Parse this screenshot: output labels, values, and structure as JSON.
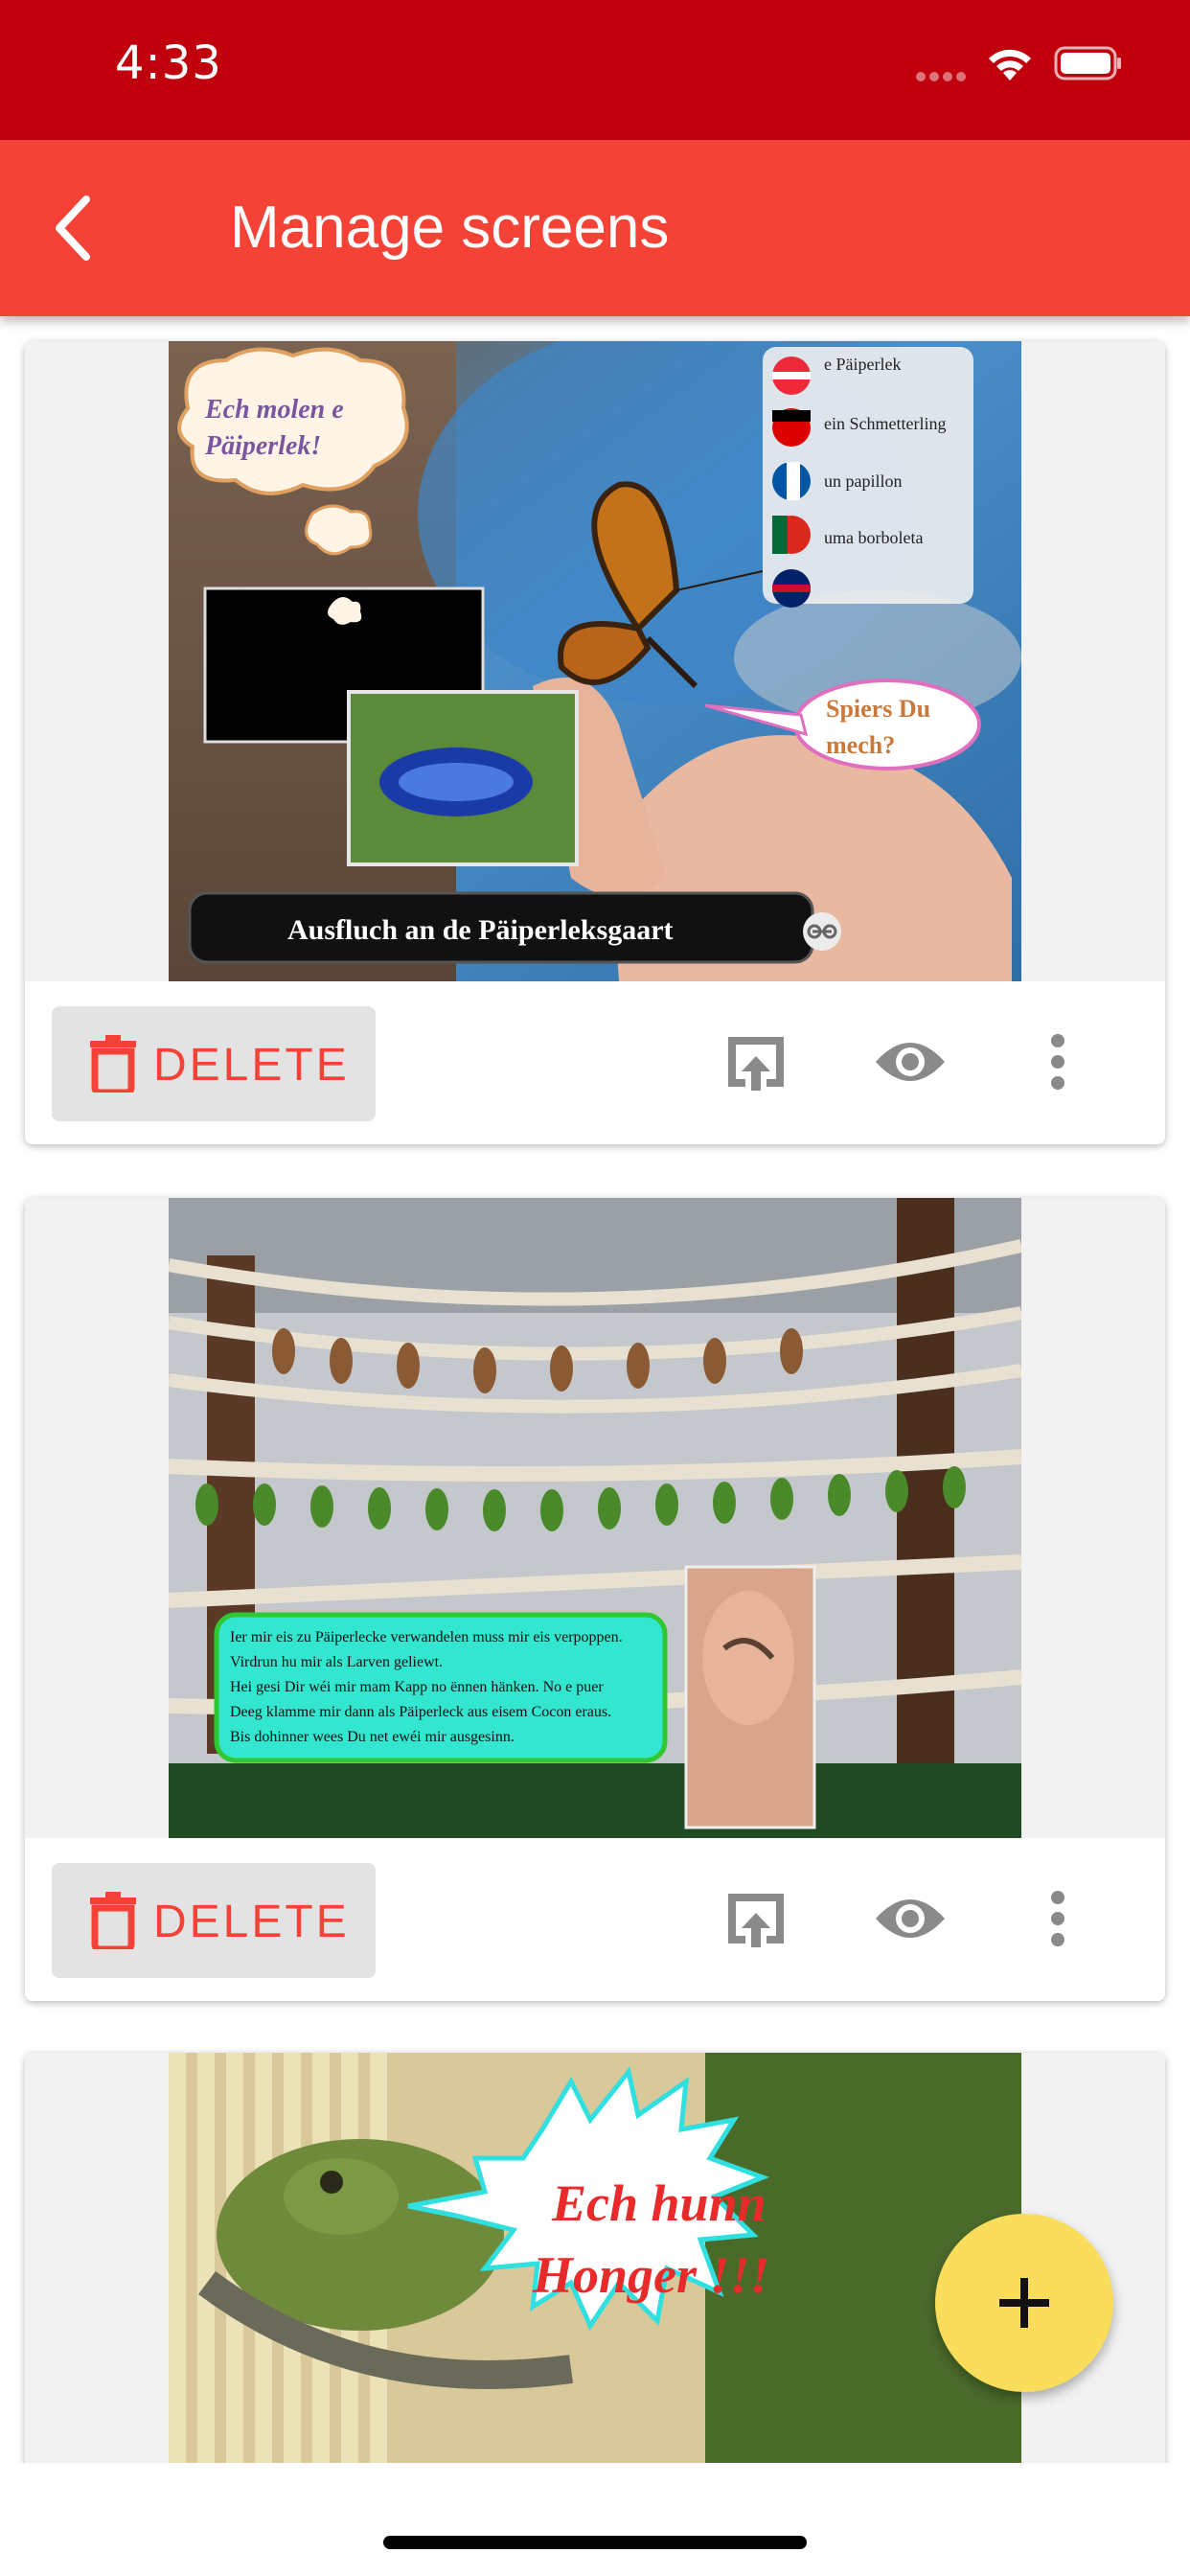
{
  "status_bar": {
    "time": "4:33"
  },
  "app_bar": {
    "title": "Manage screens",
    "back_icon": "arrow-back-icon"
  },
  "cards": [
    {
      "delete_label": "DELETE",
      "thumbnail": {
        "bubble_top": "Ech molen e Päiperlek!",
        "languages": [
          "e Päiperlek",
          "ein Schmetterling",
          "un papillon",
          "uma borboleta"
        ],
        "bubble_speech": "Spiers Du mech?",
        "banner": "Ausfluch an de Päiperleksgaart"
      }
    },
    {
      "delete_label": "DELETE",
      "thumbnail": {
        "text_lines": [
          "Ier mir eis zu Päiperlecke verwandelen muss mir eis verpoppen.",
          "Virdrun hu mir als Larven geliewt.",
          "Hei gesi Dir wéi mir mam Kapp no ënnen hänken.  No e puer",
          "Deeg klamme mir dann als Päiperleck aus eisem Cocon eraus.",
          "Bis dohinner wees Du net ewéi mir ausgesinn."
        ]
      }
    },
    {
      "thumbnail": {
        "shout_line1": "Ech hunn",
        "shout_line2": "Honger !!!"
      }
    }
  ],
  "fab": {
    "icon": "plus-icon"
  },
  "colors": {
    "status_bar": "#c1000d",
    "app_bar": "#f44336",
    "accent": "#f44336",
    "fab": "#fbdd5c"
  }
}
